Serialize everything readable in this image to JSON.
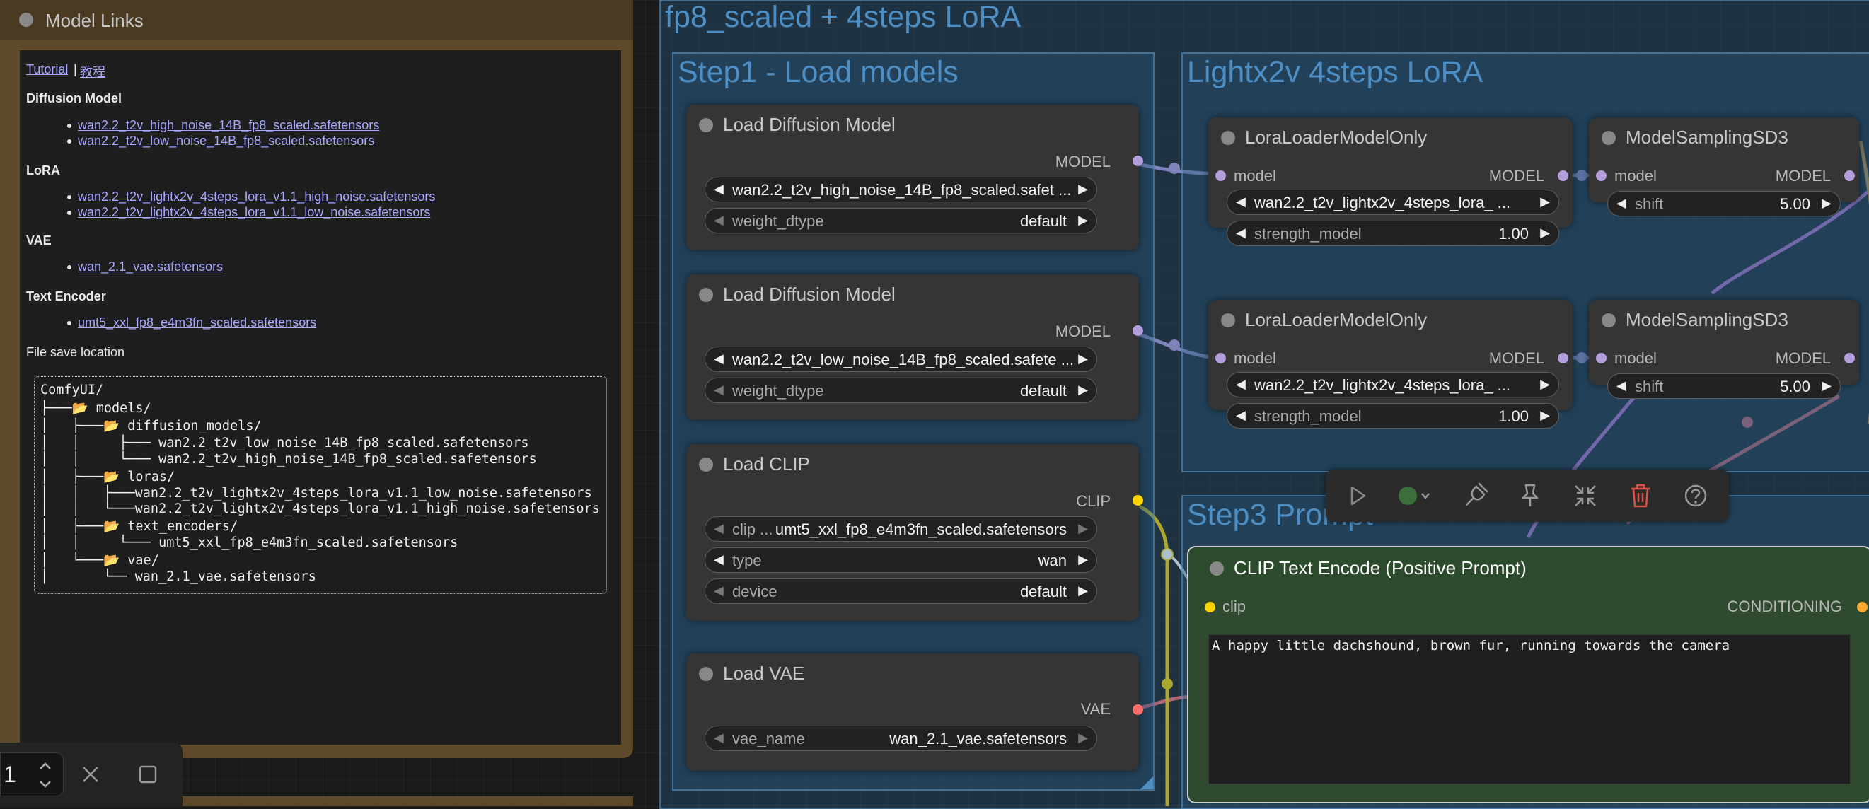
{
  "note": {
    "title": "Model Links",
    "tutorial_en": "Tutorial",
    "sep": "|",
    "tutorial_cn": "教程",
    "sections": [
      {
        "heading": "Diffusion Model",
        "links": [
          "wan2.2_t2v_high_noise_14B_fp8_scaled.safetensors",
          "wan2.2_t2v_low_noise_14B_fp8_scaled.safetensors"
        ]
      },
      {
        "heading": "LoRA",
        "links": [
          "wan2.2_t2v_lightx2v_4steps_lora_v1.1_high_noise.safetensors",
          "wan2.2_t2v_lightx2v_4steps_lora_v1.1_low_noise.safetensors"
        ]
      },
      {
        "heading": "VAE",
        "links": [
          "wan_2.1_vae.safetensors"
        ]
      },
      {
        "heading": "Text Encoder",
        "links": [
          "umt5_xxl_fp8_e4m3fn_scaled.safetensors"
        ]
      }
    ],
    "save_location": "File save location",
    "tree": [
      "ComfyUI/",
      "├───📂 models/",
      "│   ├───📂 diffusion_models/",
      "│   │     ├─── wan2.2_t2v_low_noise_14B_fp8_scaled.safetensors",
      "│   │     └─── wan2.2_t2v_high_noise_14B_fp8_scaled.safetensors",
      "│   ├───📂 loras/",
      "│   │   ├───wan2.2_t2v_lightx2v_4steps_lora_v1.1_low_noise.safetensors",
      "│   │   └───wan2.2_t2v_lightx2v_4steps_lora_v1.1_high_noise.safetensors",
      "│   ├───📂 text_encoders/",
      "│   │     └─── umt5_xxl_fp8_e4m3fn_scaled.safetensors",
      "│   └───📂 vae/",
      "│       └── wan_2.1_vae.safetensors"
    ]
  },
  "controls": {
    "batch_value": "1"
  },
  "groups": {
    "main": "fp8_scaled +  4steps LoRA",
    "step1": "Step1 - Load models",
    "lora": "Lightx2v 4steps LoRA",
    "step3": "Step3 Prompt"
  },
  "nodes": {
    "diff1": {
      "title": "Load Diffusion Model",
      "output": "MODEL",
      "unet_value": "wan2.2_t2v_high_noise_14B_fp8_scaled.safet ...",
      "dtype_label": "weight_dtype",
      "dtype_value": "default"
    },
    "diff2": {
      "title": "Load Diffusion Model",
      "output": "MODEL",
      "unet_value": "wan2.2_t2v_low_noise_14B_fp8_scaled.safete ...",
      "dtype_label": "weight_dtype",
      "dtype_value": "default"
    },
    "clip": {
      "title": "Load CLIP",
      "output": "CLIP",
      "clip_label": "clip ...",
      "clip_value": "umt5_xxl_fp8_e4m3fn_scaled.safetensors",
      "type_label": "type",
      "type_value": "wan",
      "device_label": "device",
      "device_value": "default"
    },
    "vae": {
      "title": "Load VAE",
      "output": "VAE",
      "name_label": "vae_name",
      "name_value": "wan_2.1_vae.safetensors"
    },
    "lora1": {
      "title": "LoraLoaderModelOnly",
      "input": "model",
      "output": "MODEL",
      "lora_value": "wan2.2_t2v_lightx2v_4steps_lora_ ...",
      "strength_label": "strength_model",
      "strength_value": "1.00"
    },
    "lora2": {
      "title": "LoraLoaderModelOnly",
      "input": "model",
      "output": "MODEL",
      "lora_value": "wan2.2_t2v_lightx2v_4steps_lora_ ...",
      "strength_label": "strength_model",
      "strength_value": "1.00"
    },
    "ms1": {
      "title": "ModelSamplingSD3",
      "input": "model",
      "output": "MODEL",
      "shift_label": "shift",
      "shift_value": "5.00"
    },
    "ms2": {
      "title": "ModelSamplingSD3",
      "input": "model",
      "output": "MODEL",
      "shift_label": "shift",
      "shift_value": "5.00"
    },
    "clipenc": {
      "title": "CLIP Text Encode (Positive Prompt)",
      "input": "clip",
      "output": "CONDITIONING",
      "text": "A happy little dachshound, brown fur, running towards the camera"
    }
  },
  "colors": {
    "model": "#b39ddb",
    "clip": "#ffd500",
    "vae": "#ff6e6e",
    "conditioning": "#ffa931",
    "group": "#4d8ec4",
    "note": "#5e4a2b"
  }
}
